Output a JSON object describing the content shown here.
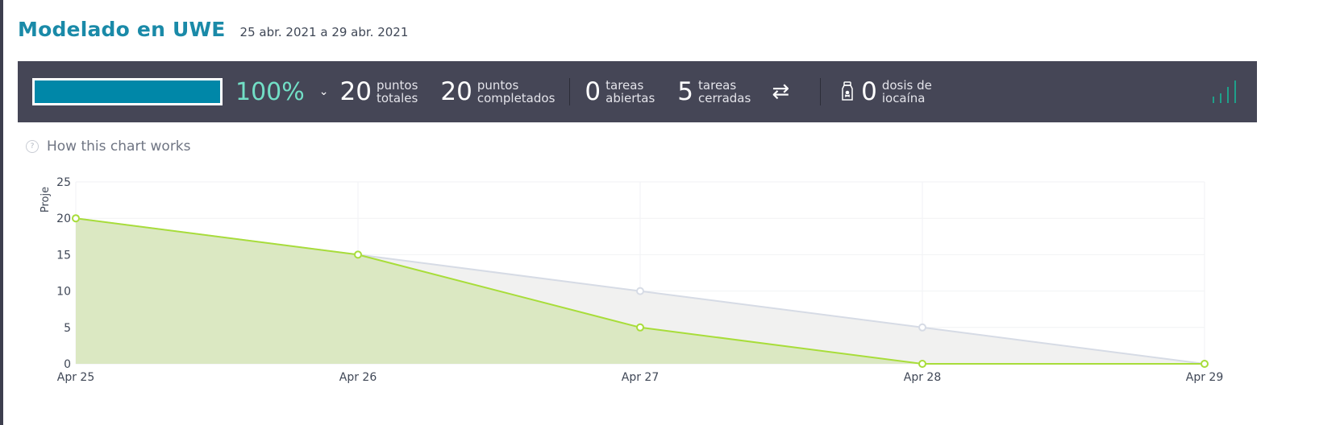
{
  "header": {
    "title": "Modelado en UWE",
    "date_range": "25 abr. 2021 a 29 abr. 2021"
  },
  "summary": {
    "progress_fraction": 1.0,
    "percent_label": "100%",
    "total_points": {
      "value": "20",
      "label": "puntos\ntotales"
    },
    "completed_points": {
      "value": "20",
      "label": "puntos\ncompletados"
    },
    "open_tasks": {
      "value": "0",
      "label": "tareas\nabiertas"
    },
    "closed_tasks": {
      "value": "5",
      "label": "tareas\ncerradas"
    },
    "iocaine": {
      "value": "0",
      "label": "dosis de\niocaína"
    },
    "colors": {
      "bar_bg": "#454656",
      "progress": "#0087a8",
      "percent": "#72dfc6",
      "stats_icon": "#1fa08a"
    }
  },
  "help": {
    "label": "How this chart works",
    "icon": "question-icon"
  },
  "chart_data": {
    "type": "area",
    "categories": [
      "Apr 25",
      "Apr 26",
      "Apr 27",
      "Apr 28",
      "Apr 29"
    ],
    "ylabel": "Proje",
    "ylim": [
      0,
      25
    ],
    "yticks": [
      "0",
      "5",
      "10",
      "15",
      "20",
      "25"
    ],
    "grid": true,
    "series": [
      {
        "values": [
          20,
          15,
          10,
          5,
          0
        ],
        "color": "#d6dbe5",
        "fill": "#f1f1f0"
      },
      {
        "values": [
          20,
          15,
          5,
          0,
          0
        ],
        "color": "#a8dd3a",
        "fill": "#dbe8c2"
      }
    ]
  }
}
